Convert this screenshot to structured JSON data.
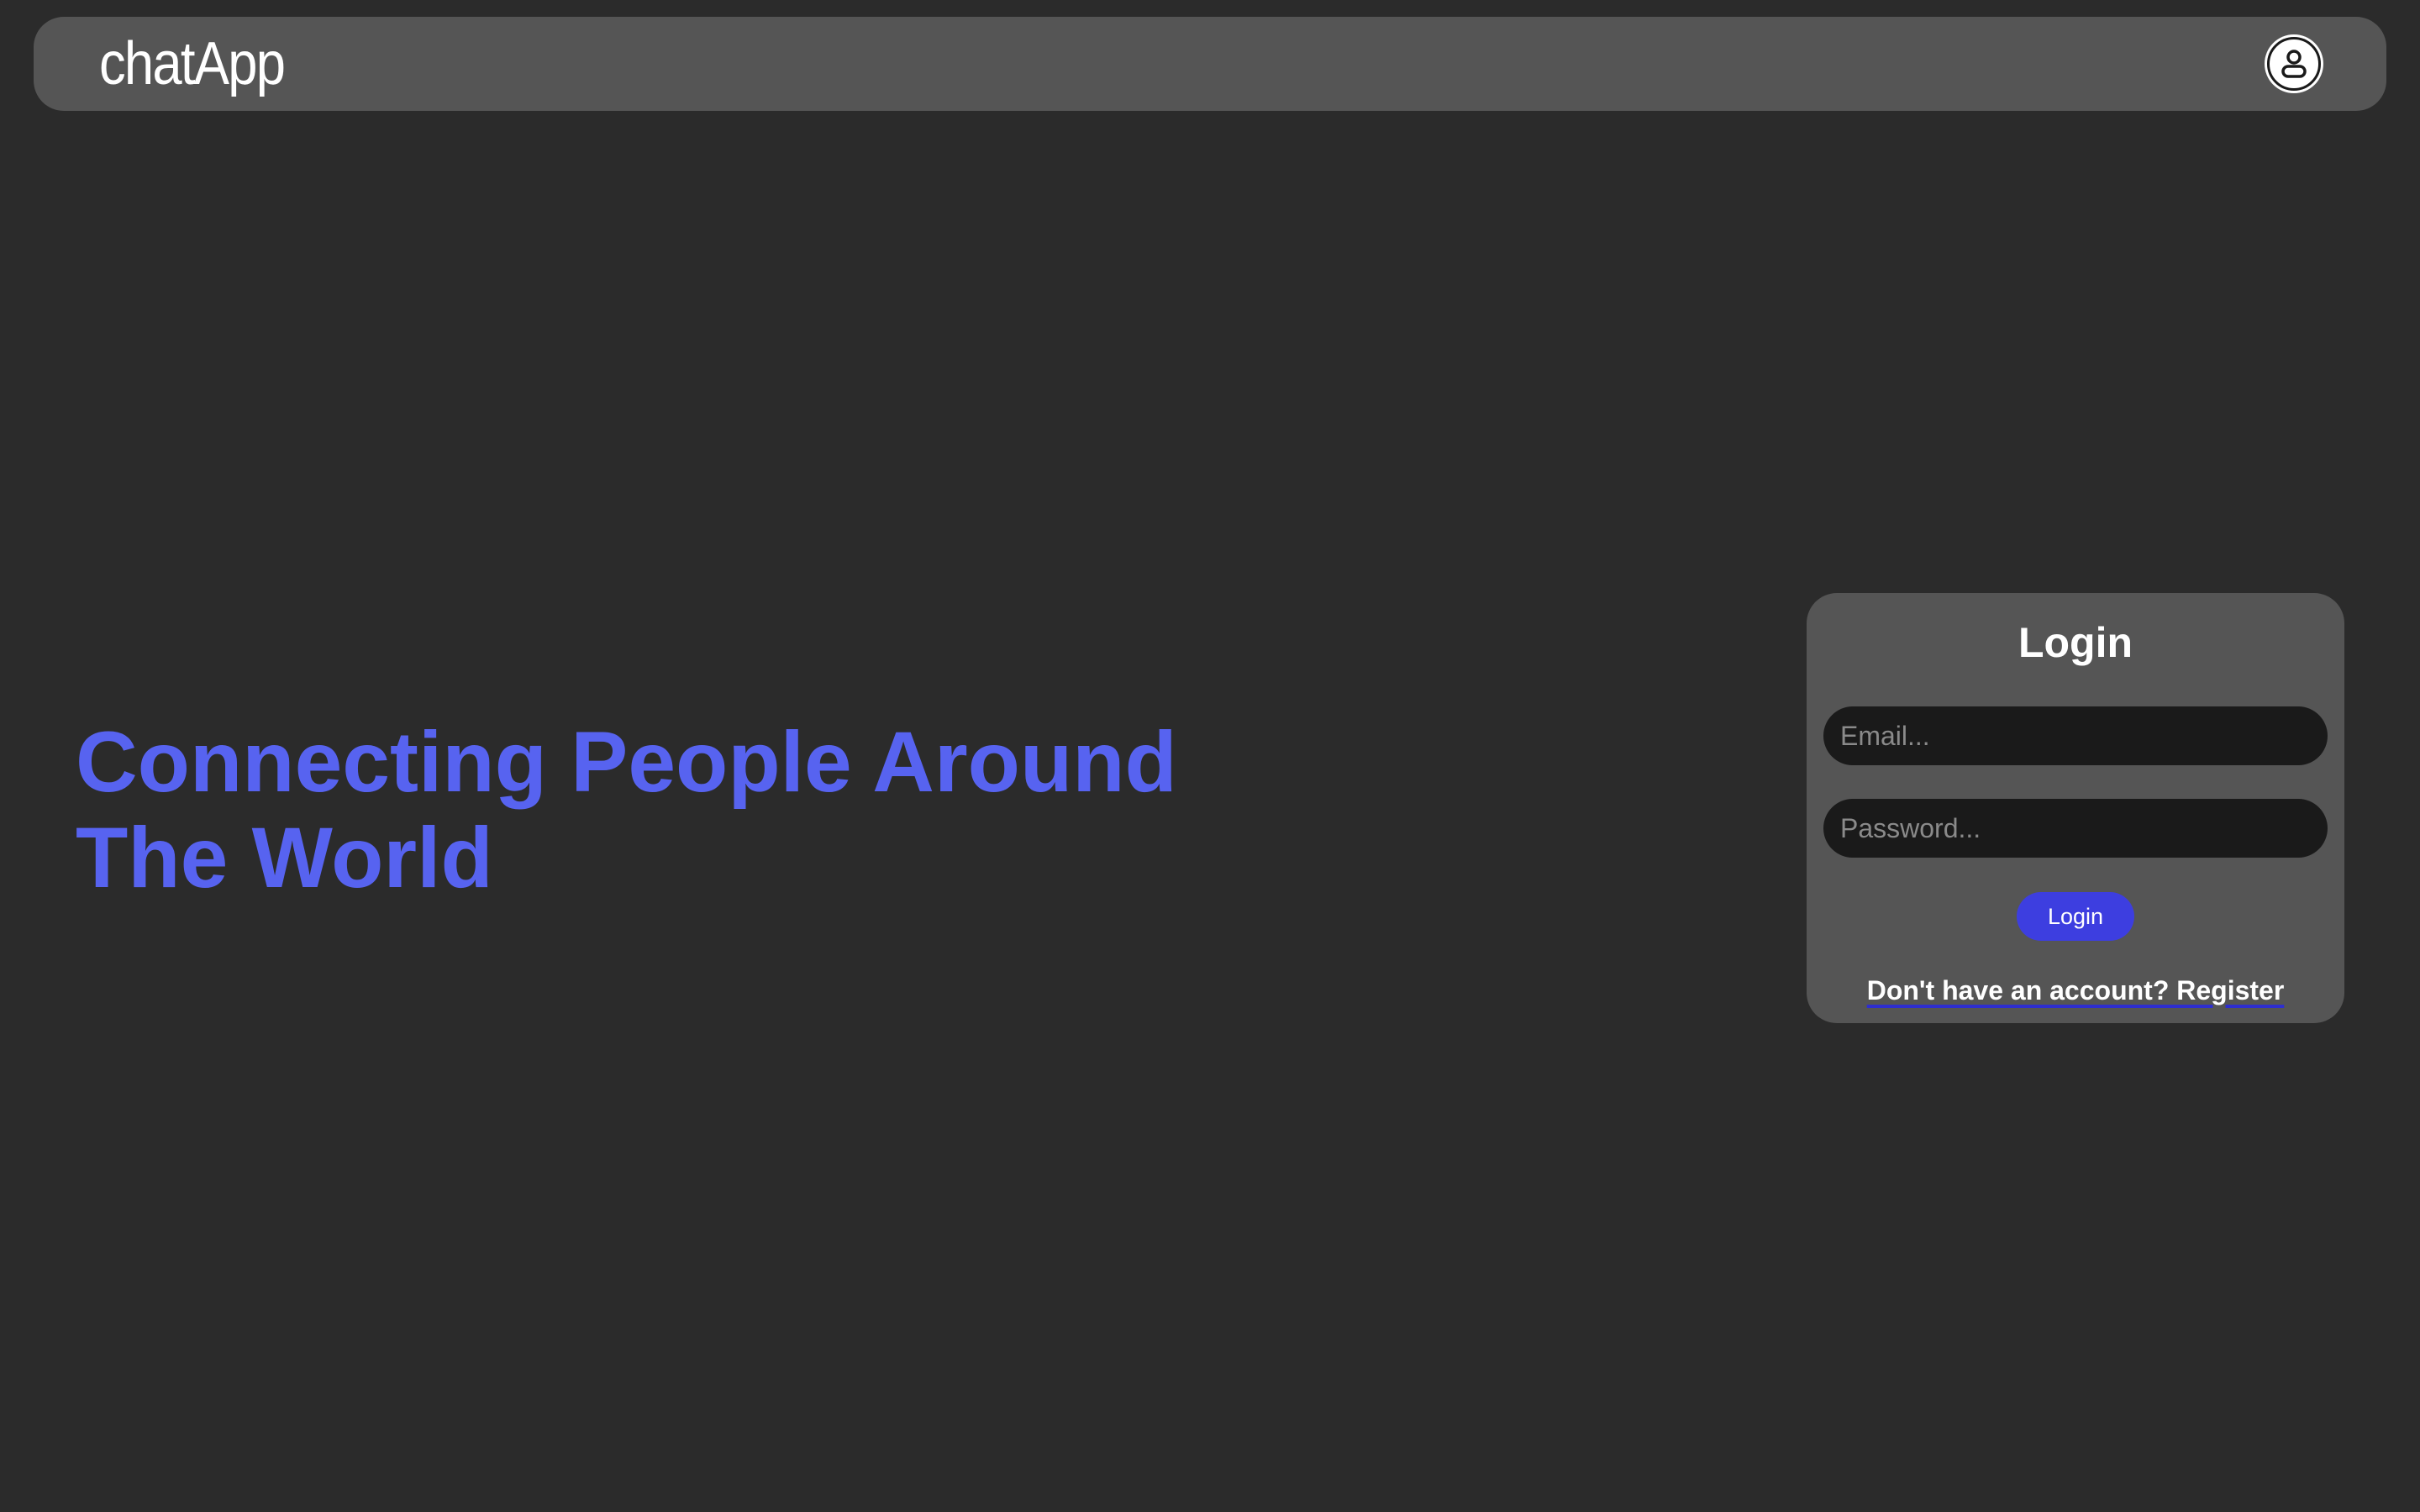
{
  "navbar": {
    "brand": "chatApp",
    "avatar_icon": "user-avatar-icon"
  },
  "hero": {
    "headline_line1": "Connecting People Around",
    "headline_line2": "The World"
  },
  "login": {
    "title": "Login",
    "email_placeholder": "Email...",
    "email_value": "",
    "password_placeholder": "Password...",
    "password_value": "",
    "submit_label": "Login",
    "register_link": "Don't have an account? Register"
  },
  "colors": {
    "background": "#2b2b2b",
    "panel": "#555555",
    "accent_headline": "#5763f0",
    "button": "#3d3ee0",
    "input_bg": "#1a1a1a"
  }
}
